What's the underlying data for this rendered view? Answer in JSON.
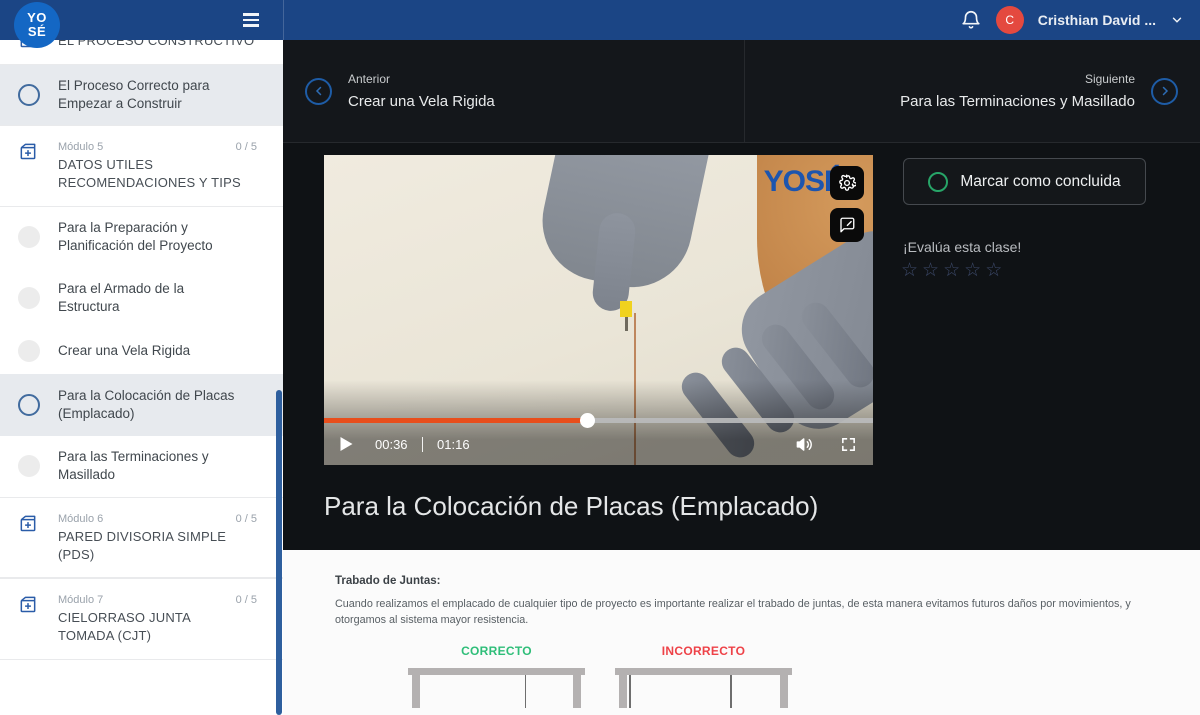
{
  "topbar": {
    "logo_line1": "YO",
    "logo_line2": "SÉ",
    "user_name": "Cristhian David ...",
    "avatar_initial": "C"
  },
  "sidebar": {
    "entries": [
      {
        "type": "module",
        "label": "",
        "count": "",
        "title": "EL PROCESO CONSTRUCTIVO"
      },
      {
        "type": "lesson",
        "state": "active",
        "title": "El Proceso Correcto para Empezar a Construir"
      },
      {
        "type": "module",
        "label": "Módulo 5",
        "count": "0 / 5",
        "title": "DATOS UTILES RECOMENDACIONES Y TIPS"
      },
      {
        "type": "lesson",
        "state": "incomplete",
        "title": "Para la Preparación y Planificación del Proyecto"
      },
      {
        "type": "lesson",
        "state": "incomplete",
        "title": "Para el Armado de la Estructura"
      },
      {
        "type": "lesson",
        "state": "incomplete",
        "title": "Crear una Vela Rigida"
      },
      {
        "type": "lesson",
        "state": "active",
        "title": "Para la Colocación de Placas (Emplacado)"
      },
      {
        "type": "lesson",
        "state": "incomplete",
        "title": "Para las Terminaciones y Masillado"
      },
      {
        "type": "module",
        "label": "Módulo 6",
        "count": "0 / 5",
        "title": "PARED DIVISORIA SIMPLE (PDS)"
      },
      {
        "type": "module",
        "label": "Módulo 7",
        "count": "0 / 5",
        "title": "CIELORRASO JUNTA TOMADA (CJT)"
      }
    ]
  },
  "lesson_nav": {
    "prev_label": "Anterior",
    "prev_title": "Crear una Vela Rigida",
    "next_label": "Siguiente",
    "next_title": "Para las Terminaciones y Masillado"
  },
  "player": {
    "current_time": "00:36",
    "duration": "01:16",
    "progress_percent": 48,
    "watermark": "YOSÉ"
  },
  "lesson": {
    "title": "Para la Colocación de Placas (Emplacado)",
    "complete_button": "Marcar como concluida",
    "rate_label": "¡Evalúa esta clase!",
    "star_count": 5,
    "star_glyph": "☆"
  },
  "content": {
    "heading": "Trabado de Juntas:",
    "paragraph": "Cuando realizamos el emplacado de cualquier tipo de proyecto es importante realizar el trabado de juntas, de esta manera evitamos futuros daños por movimientos, y otorgamos al sistema mayor resistencia.",
    "correct_label": "CORRECTO",
    "incorrect_label": "INCORRECTO"
  },
  "colors": {
    "topbar_blue": "#1b4585",
    "logo_blue": "#1467c4",
    "accent_blue": "#1e5ca6",
    "scrollbar_blue": "#2e5f9e",
    "avatar_red": "#e4493f",
    "progress_orange": "#e84e1c",
    "success_green": "#27a568",
    "correct_green": "#2fbe79",
    "incorrect_red": "#ee4248",
    "watermark_blue": "#1d55ae",
    "active_row_bg": "#e7eaee"
  }
}
